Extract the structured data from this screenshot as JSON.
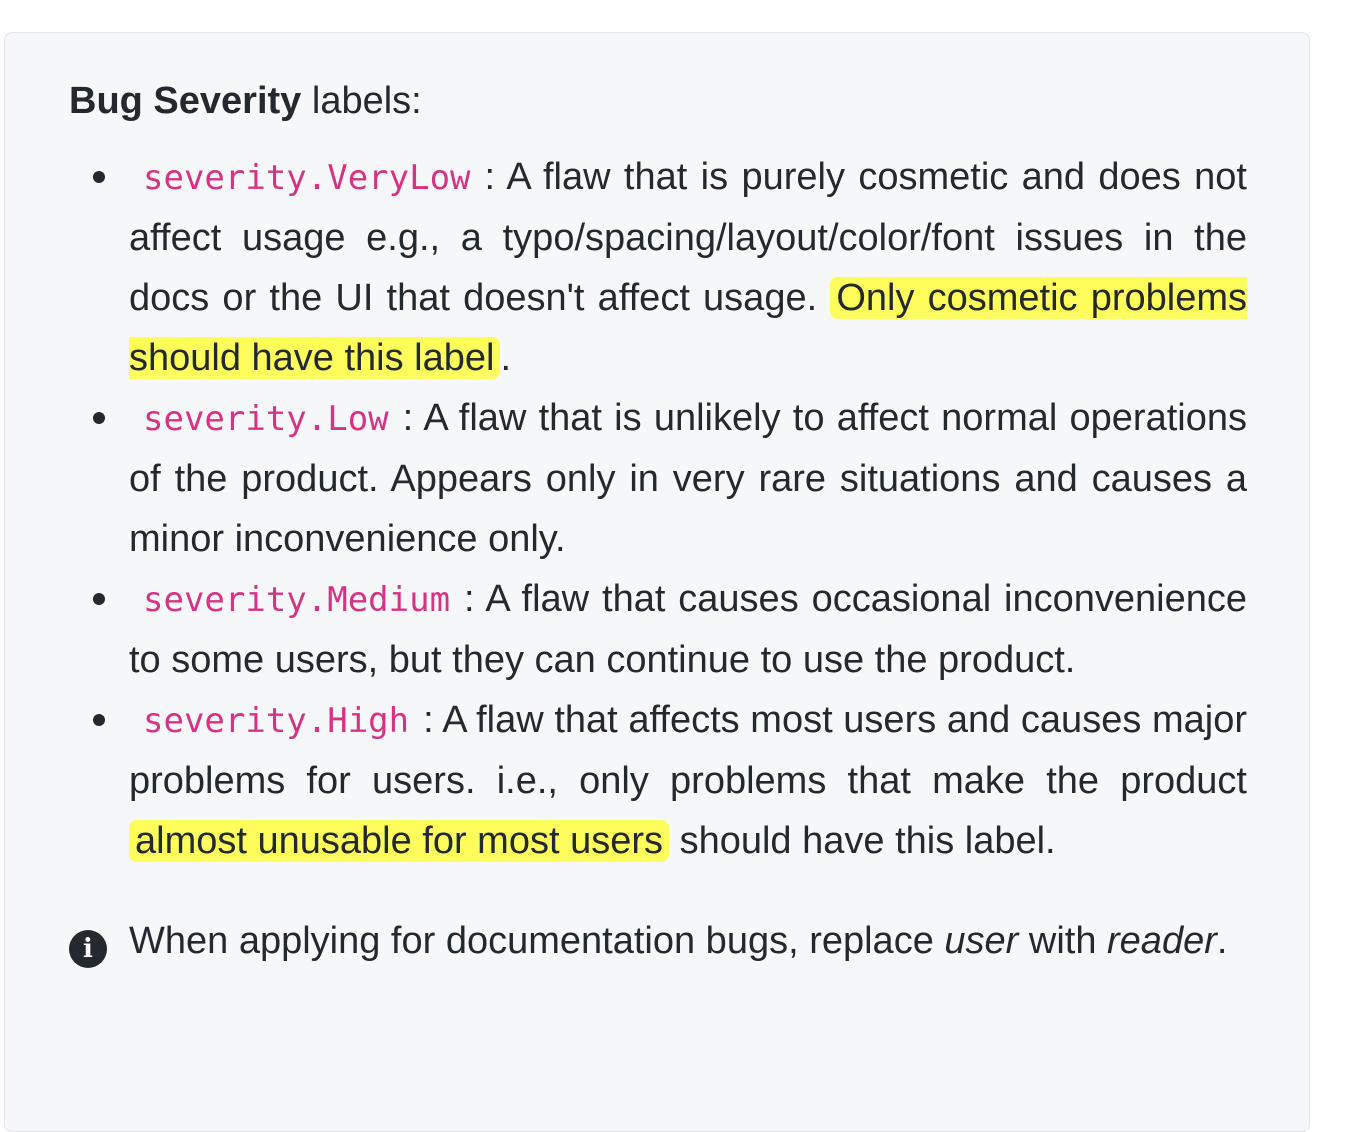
{
  "heading": {
    "bold": "Bug Severity",
    "rest": " labels:"
  },
  "items": [
    {
      "code": "severity.VeryLow",
      "text": ": A flaw that is purely cosmetic and does not affect usage e.g., a typo/spacing/layout/color/font issues in the docs or the UI that doesn't affect usage. ",
      "highlight": "Only cosmetic problems should have this label",
      "tail": "."
    },
    {
      "code": "severity.Low",
      "text": ": A flaw that is unlikely to affect normal operations of the product. Appears only in very rare situations and causes a minor inconvenience only."
    },
    {
      "code": "severity.Medium",
      "text": ": A flaw that causes occasional inconvenience to some users, but they can continue to use the product."
    },
    {
      "code": "severity.High",
      "text": ": A flaw that affects most users and causes major problems for users. i.e., only problems that make the product ",
      "highlight": "almost unusable for most users",
      "tail": " should have this label."
    }
  ],
  "note": {
    "icon": "info-icon",
    "text1": "When applying for documentation bugs, replace ",
    "em1": "user",
    "text2": " with ",
    "em2": "reader",
    "text3": "."
  }
}
